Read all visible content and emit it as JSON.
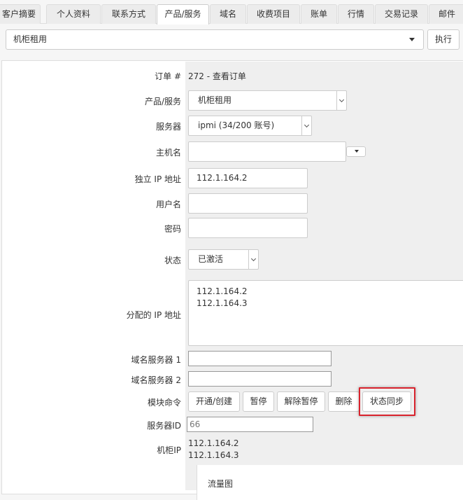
{
  "tabs": [
    "客户摘要",
    "个人资料",
    "联系方式",
    "产品/服务",
    "域名",
    "收费项目",
    "账单",
    "行情",
    "交易记录",
    "邮件"
  ],
  "active_tab": "产品/服务",
  "product_selector": {
    "value": "机柜租用",
    "run_label": "执行"
  },
  "labels": {
    "order": "订单 #",
    "product": "产品/服务",
    "server": "服务器",
    "hostname": "主机名",
    "dedicated_ip": "独立 IP 地址",
    "username": "用户名",
    "password": "密码",
    "status": "状态",
    "assigned_ips": "分配的 IP 地址",
    "ns1": "域名服务器 1",
    "ns2": "域名服务器 2",
    "module_commands": "模块命令",
    "server_id": "服务器ID",
    "rack_ip": "机柜IP"
  },
  "values": {
    "order": "272 - 查看订单",
    "product": "机柜租用",
    "server": "ipmi (34/200 账号)",
    "hostname": "",
    "dedicated_ip": "112.1.164.2",
    "username": "",
    "password": "",
    "status": "已激活",
    "assigned_ips": [
      "112.1.164.2",
      "112.1.164.3"
    ],
    "ns1": "",
    "ns2": "",
    "server_id": "66",
    "rack_ip": [
      "112.1.164.2",
      "112.1.164.3"
    ]
  },
  "module_buttons": {
    "create": "开通/创建",
    "suspend": "暂停",
    "unsuspend": "解除暂停",
    "terminate": "删除",
    "sync": "状态同步"
  },
  "traffic_title": "流量图",
  "colors": {
    "highlight": "#d9232d"
  }
}
